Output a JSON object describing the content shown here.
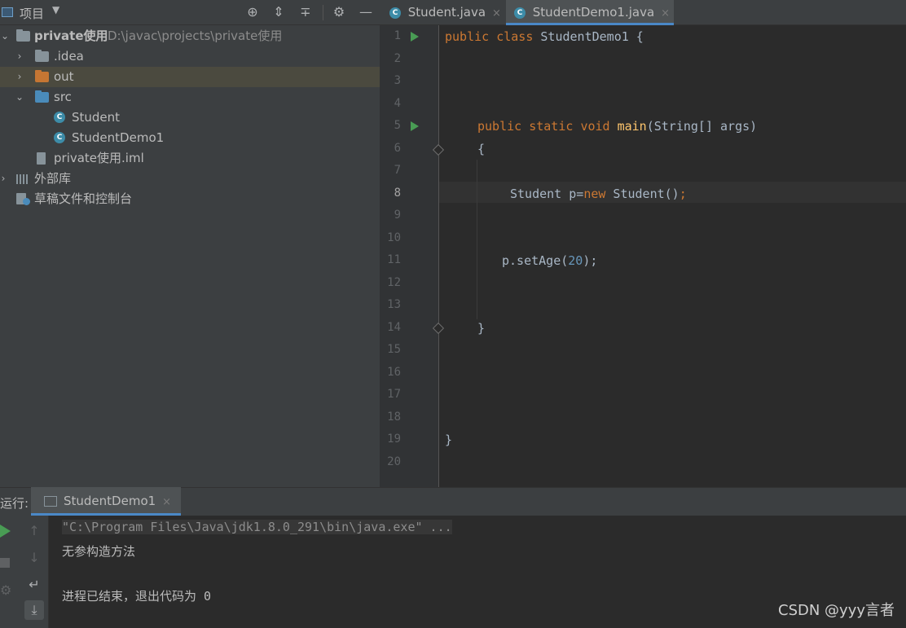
{
  "project_header": {
    "title": "项目",
    "dropdown_icon": "chevron-down-icon"
  },
  "toolbar_icons": [
    "locate-icon",
    "expand-all-icon",
    "collapse-all-icon",
    "gear-icon",
    "minimize-icon"
  ],
  "tabs": [
    {
      "label": "Student.java",
      "close": "×"
    },
    {
      "label": "StudentDemo1.java",
      "close": "×"
    }
  ],
  "tree": {
    "root": {
      "name": "private使用",
      "path": "D:\\javac\\projects\\private使用"
    },
    "idea": ".idea",
    "out": "out",
    "src": "src",
    "student": "Student",
    "studentdemo1": "StudentDemo1",
    "iml": "private使用.iml",
    "external": "外部库",
    "scratches": "草稿文件和控制台"
  },
  "line_numbers": [
    "1",
    "2",
    "3",
    "4",
    "5",
    "6",
    "7",
    "8",
    "9",
    "10",
    "11",
    "12",
    "13",
    "14",
    "15",
    "16",
    "17",
    "18",
    "19",
    "20"
  ],
  "code": {
    "l1_kw1": "public",
    "l1_kw2": "class",
    "l1_rest": "StudentDemo1 {",
    "l5_kw1": "public",
    "l5_kw2": "static",
    "l5_kw3": "void",
    "l5_fn": "main",
    "l5_rest": "(String[] args)",
    "l6": "{",
    "l8_a": "Student p=",
    "l8_kw": "new",
    "l8_b": " Student()",
    "l8_semi": ";",
    "l11_a": "p.setAge(",
    "l11_num": "20",
    "l11_b": ");",
    "l14": "}",
    "l19": "}"
  },
  "run": {
    "label": "运行:",
    "tab": "StudentDemo1",
    "tab_close": "×",
    "console": [
      "\"C:\\Program Files\\Java\\jdk1.8.0_291\\bin\\java.exe\" ...",
      "无参构造方法",
      "",
      "进程已结束，退出代码为 0"
    ]
  },
  "watermark": "CSDN @yyy言者",
  "colors": {
    "keyword": "#cc7832",
    "function": "#ffc66d",
    "number": "#6897bb",
    "run_green": "#499c54",
    "tab_underline": "#4a88c7"
  }
}
